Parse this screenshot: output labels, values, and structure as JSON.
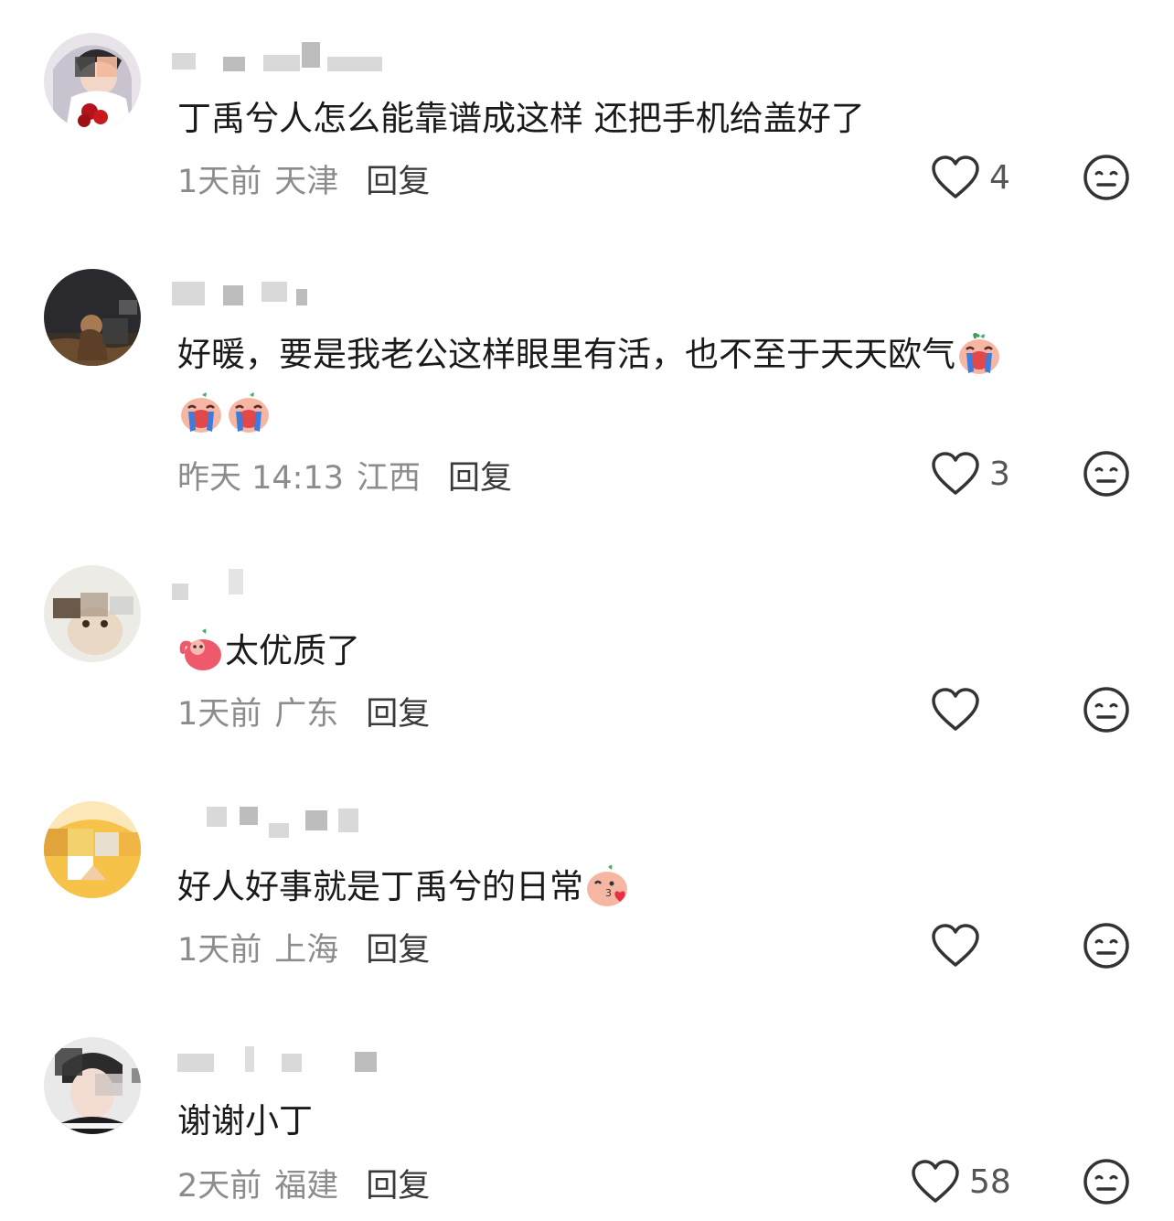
{
  "comments": [
    {
      "text": "丁禹兮人怎么能靠谱成这样 还把手机给盖好了",
      "text2": "",
      "time": "1天前",
      "location": "天津",
      "reply": "回复",
      "likes": "4",
      "avatar": "photo-avatar-1"
    },
    {
      "text": "好暖，要是我老公这样眼里有活，也不至于天天欧气",
      "text2": "",
      "time": "昨天 14:13",
      "location": "江西",
      "reply": "回复",
      "likes": "3",
      "avatar": "photo-avatar-2",
      "emojis": [
        "crying-emoji",
        "crying-emoji",
        "crying-emoji"
      ]
    },
    {
      "text": "太优质了",
      "text2": "",
      "time": "1天前",
      "location": "广东",
      "reply": "回复",
      "likes": "",
      "avatar": "photo-avatar-3",
      "emojis": [
        "waving-emoji"
      ]
    },
    {
      "text": "好人好事就是丁禹兮的日常",
      "text2": "",
      "time": "1天前",
      "location": "上海",
      "reply": "回复",
      "likes": "",
      "avatar": "photo-avatar-4",
      "emojis": [
        "kiss-emoji"
      ]
    },
    {
      "text": "谢谢小丁",
      "text2": "",
      "time": "2天前",
      "location": "福建",
      "reply": "回复",
      "likes": "58",
      "avatar": "photo-avatar-5"
    }
  ],
  "icons": {
    "like": "heart-outline-icon",
    "dislike": "meh-face-icon"
  },
  "colors": {
    "meta": "#8c8c8c",
    "text": "#1a1a1a",
    "icon": "#333333"
  }
}
